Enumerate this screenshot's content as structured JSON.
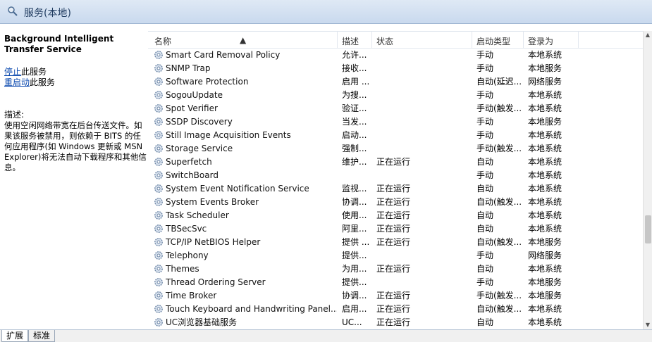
{
  "header": {
    "title": "服务(本地)"
  },
  "left_panel": {
    "service_title": "Background Intelligent Transfer Service",
    "stop_link": "停止",
    "stop_suffix": "此服务",
    "restart_link": "重启动",
    "restart_suffix": "此服务",
    "desc_label": "描述:",
    "desc_text": "使用空闲网络带宽在后台传送文件。如果该服务被禁用，则依赖于 BITS 的任何应用程序(如 Windows 更新或 MSN Explorer)将无法自动下载程序和其他信息。"
  },
  "columns": {
    "name": "名称",
    "desc": "描述",
    "status": "状态",
    "startup": "启动类型",
    "logon": "登录为"
  },
  "rows": [
    {
      "name": "Smart Card Removal Policy",
      "desc": "允许...",
      "status": "",
      "startup": "手动",
      "logon": "本地系统"
    },
    {
      "name": "SNMP Trap",
      "desc": "接收...",
      "status": "",
      "startup": "手动",
      "logon": "本地服务"
    },
    {
      "name": "Software Protection",
      "desc": "启用 ...",
      "status": "",
      "startup": "自动(延迟...",
      "logon": "网络服务"
    },
    {
      "name": "SogouUpdate",
      "desc": "为搜...",
      "status": "",
      "startup": "手动",
      "logon": "本地系统"
    },
    {
      "name": "Spot Verifier",
      "desc": "验证...",
      "status": "",
      "startup": "手动(触发...",
      "logon": "本地系统"
    },
    {
      "name": "SSDP Discovery",
      "desc": "当发...",
      "status": "",
      "startup": "手动",
      "logon": "本地服务"
    },
    {
      "name": "Still Image Acquisition Events",
      "desc": "启动...",
      "status": "",
      "startup": "手动",
      "logon": "本地系统"
    },
    {
      "name": "Storage Service",
      "desc": "强制...",
      "status": "",
      "startup": "手动(触发...",
      "logon": "本地系统"
    },
    {
      "name": "Superfetch",
      "desc": "维护...",
      "status": "正在运行",
      "startup": "自动",
      "logon": "本地系统"
    },
    {
      "name": "SwitchBoard",
      "desc": "",
      "status": "",
      "startup": "手动",
      "logon": "本地系统"
    },
    {
      "name": "System Event Notification Service",
      "desc": "监视...",
      "status": "正在运行",
      "startup": "自动",
      "logon": "本地系统"
    },
    {
      "name": "System Events Broker",
      "desc": "协调...",
      "status": "正在运行",
      "startup": "自动(触发...",
      "logon": "本地系统"
    },
    {
      "name": "Task Scheduler",
      "desc": "使用...",
      "status": "正在运行",
      "startup": "自动",
      "logon": "本地系统"
    },
    {
      "name": "TBSecSvc",
      "desc": "阿里...",
      "status": "正在运行",
      "startup": "自动",
      "logon": "本地系统"
    },
    {
      "name": "TCP/IP NetBIOS Helper",
      "desc": "提供 ...",
      "status": "正在运行",
      "startup": "自动(触发...",
      "logon": "本地服务"
    },
    {
      "name": "Telephony",
      "desc": "提供...",
      "status": "",
      "startup": "手动",
      "logon": "网络服务"
    },
    {
      "name": "Themes",
      "desc": "为用...",
      "status": "正在运行",
      "startup": "自动",
      "logon": "本地系统"
    },
    {
      "name": "Thread Ordering Server",
      "desc": "提供...",
      "status": "",
      "startup": "手动",
      "logon": "本地服务"
    },
    {
      "name": "Time Broker",
      "desc": "协调...",
      "status": "正在运行",
      "startup": "手动(触发...",
      "logon": "本地服务"
    },
    {
      "name": "Touch Keyboard and Handwriting Panel...",
      "desc": "启用...",
      "status": "正在运行",
      "startup": "自动(触发...",
      "logon": "本地系统"
    },
    {
      "name": "UC浏览器基础服务",
      "desc": "UC...",
      "status": "正在运行",
      "startup": "自动",
      "logon": "本地系统"
    }
  ],
  "tabs": {
    "extended": "扩展",
    "standard": "标准"
  },
  "colors": {
    "header_bg": "#c9d9ee",
    "link": "#0645ad"
  }
}
